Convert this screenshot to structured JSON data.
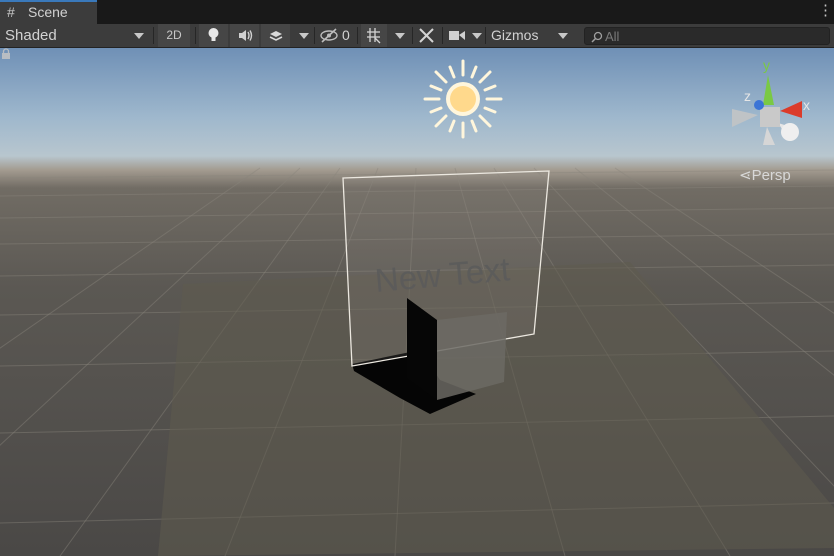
{
  "tab": {
    "icon": "grid-hash-icon",
    "label": "Scene"
  },
  "toolbar": {
    "shading_mode": "Shaded",
    "mode_2d_label": "2D",
    "lighting_icon": "lightbulb-icon",
    "audio_icon": "speaker-icon",
    "effects_icon": "layers-icon",
    "hidden_count_icon": "eye-slash-icon",
    "hidden_count": "0",
    "grid_icon": "grid-snap-icon",
    "tools_icon": "tools-icon",
    "camera_icon": "camera-icon",
    "gizmos_label": "Gizmos",
    "search_placeholder": "All",
    "search_icon": "search-icon"
  },
  "viewport": {
    "world_text": "New Text",
    "sun_icon": "directional-light-icon",
    "orientation_gizmo": {
      "y_label": "y",
      "x_label": "x",
      "z_label": "z",
      "y_color": "#7ac944",
      "x_color": "#db3b2a",
      "z_color": "#3b74d6",
      "projection_label": "Persp"
    }
  },
  "colors": {
    "accent_tab": "#3a79bb",
    "toolbar_bg": "#3c3c3c",
    "text": "#d2d2d2"
  }
}
